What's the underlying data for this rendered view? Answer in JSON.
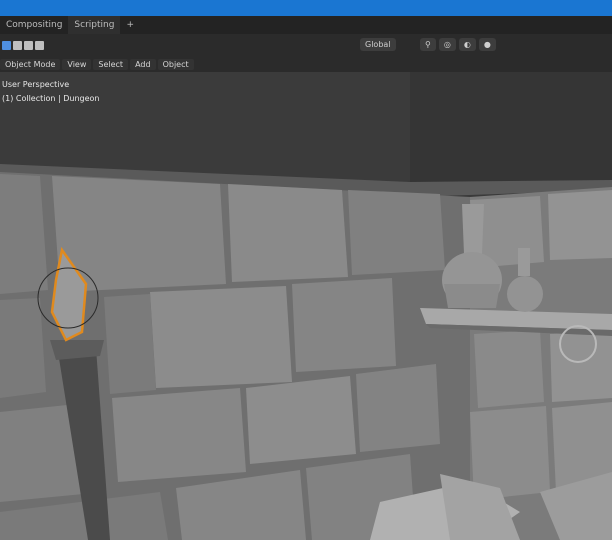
{
  "window": {
    "title_bar_color": "#1a76d2"
  },
  "tabs": [
    {
      "label": "Compositing",
      "active": false
    },
    {
      "label": "Scripting",
      "active": true
    },
    {
      "label": "+",
      "active": false
    }
  ],
  "header": {
    "mode_icons": [
      "select-box-icon",
      "select-tweak-icon",
      "select-circle-icon",
      "select-lasso-icon"
    ],
    "transform_orientation": "Global",
    "right_icons": [
      "snap-icon",
      "proportional-edit-icon",
      "overlay-icon",
      "shading-icon"
    ]
  },
  "menubar": {
    "items": [
      "Object Mode",
      "View",
      "Select",
      "Add",
      "Object"
    ]
  },
  "viewport_overlay": {
    "line1": "User Perspective",
    "line2": "(1) Collection | Dungeon"
  },
  "colors": {
    "selection_outline": "#e08a1e",
    "mesh_fill": "#8a8a8a"
  }
}
